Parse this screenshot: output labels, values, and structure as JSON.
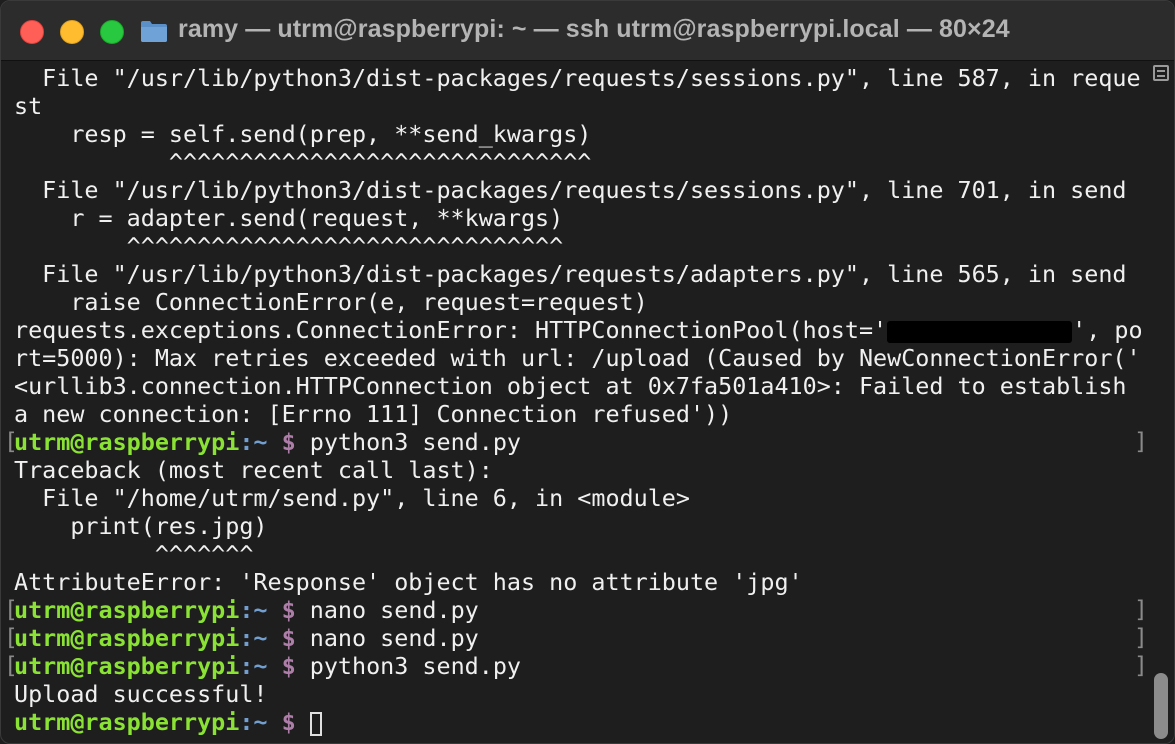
{
  "window": {
    "title": "ramy — utrm@raspberrypi: ~ — ssh utrm@raspberrypi.local — 80×24"
  },
  "terminal": {
    "lines": [
      {
        "kind": "text",
        "text": "  File \"/usr/lib/python3/dist-packages/requests/sessions.py\", line 587, in reque"
      },
      {
        "kind": "text",
        "text": "st"
      },
      {
        "kind": "text",
        "text": "    resp = self.send(prep, **send_kwargs)"
      },
      {
        "kind": "text",
        "text": "           ^^^^^^^^^^^^^^^^^^^^^^^^^^^^^^"
      },
      {
        "kind": "text",
        "text": "  File \"/usr/lib/python3/dist-packages/requests/sessions.py\", line 701, in send"
      },
      {
        "kind": "text",
        "text": "    r = adapter.send(request, **kwargs)"
      },
      {
        "kind": "text",
        "text": "        ^^^^^^^^^^^^^^^^^^^^^^^^^^^^^^^"
      },
      {
        "kind": "text",
        "text": "  File \"/usr/lib/python3/dist-packages/requests/adapters.py\", line 565, in send"
      },
      {
        "kind": "text",
        "text": "    raise ConnectionError(e, request=request)"
      },
      {
        "kind": "redacted",
        "before": "requests.exceptions.ConnectionError: HTTPConnectionPool(host='",
        "after": "', po"
      },
      {
        "kind": "text",
        "text": "rt=5000): Max retries exceeded with url: /upload (Caused by NewConnectionError('"
      },
      {
        "kind": "text",
        "text": "<urllib3.connection.HTTPConnection object at 0x7fa501a410>: Failed to establish"
      },
      {
        "kind": "text",
        "text": "a new connection: [Errno 111] Connection refused'))"
      },
      {
        "kind": "prompt",
        "command": "python3 send.py",
        "marked": true
      },
      {
        "kind": "text",
        "text": "Traceback (most recent call last):"
      },
      {
        "kind": "text",
        "text": "  File \"/home/utrm/send.py\", line 6, in <module>"
      },
      {
        "kind": "text",
        "text": "    print(res.jpg)"
      },
      {
        "kind": "text",
        "text": "          ^^^^^^^"
      },
      {
        "kind": "text",
        "text": "AttributeError: 'Response' object has no attribute 'jpg'"
      },
      {
        "kind": "prompt",
        "command": "nano send.py",
        "marked": true
      },
      {
        "kind": "prompt",
        "command": "nano send.py",
        "marked": true
      },
      {
        "kind": "prompt",
        "command": "python3 send.py",
        "marked": true
      },
      {
        "kind": "text",
        "text": "Upload successful!"
      },
      {
        "kind": "prompt",
        "command": "",
        "marked": false,
        "cursor": true
      }
    ],
    "prompt": {
      "user": "utrm@raspberrypi",
      "path": ":~",
      "symbol": " $ "
    }
  },
  "colors": {
    "background": "#1e1e1e",
    "prompt_user": "#8ae234",
    "prompt_symbol": "#ad7fa8"
  }
}
